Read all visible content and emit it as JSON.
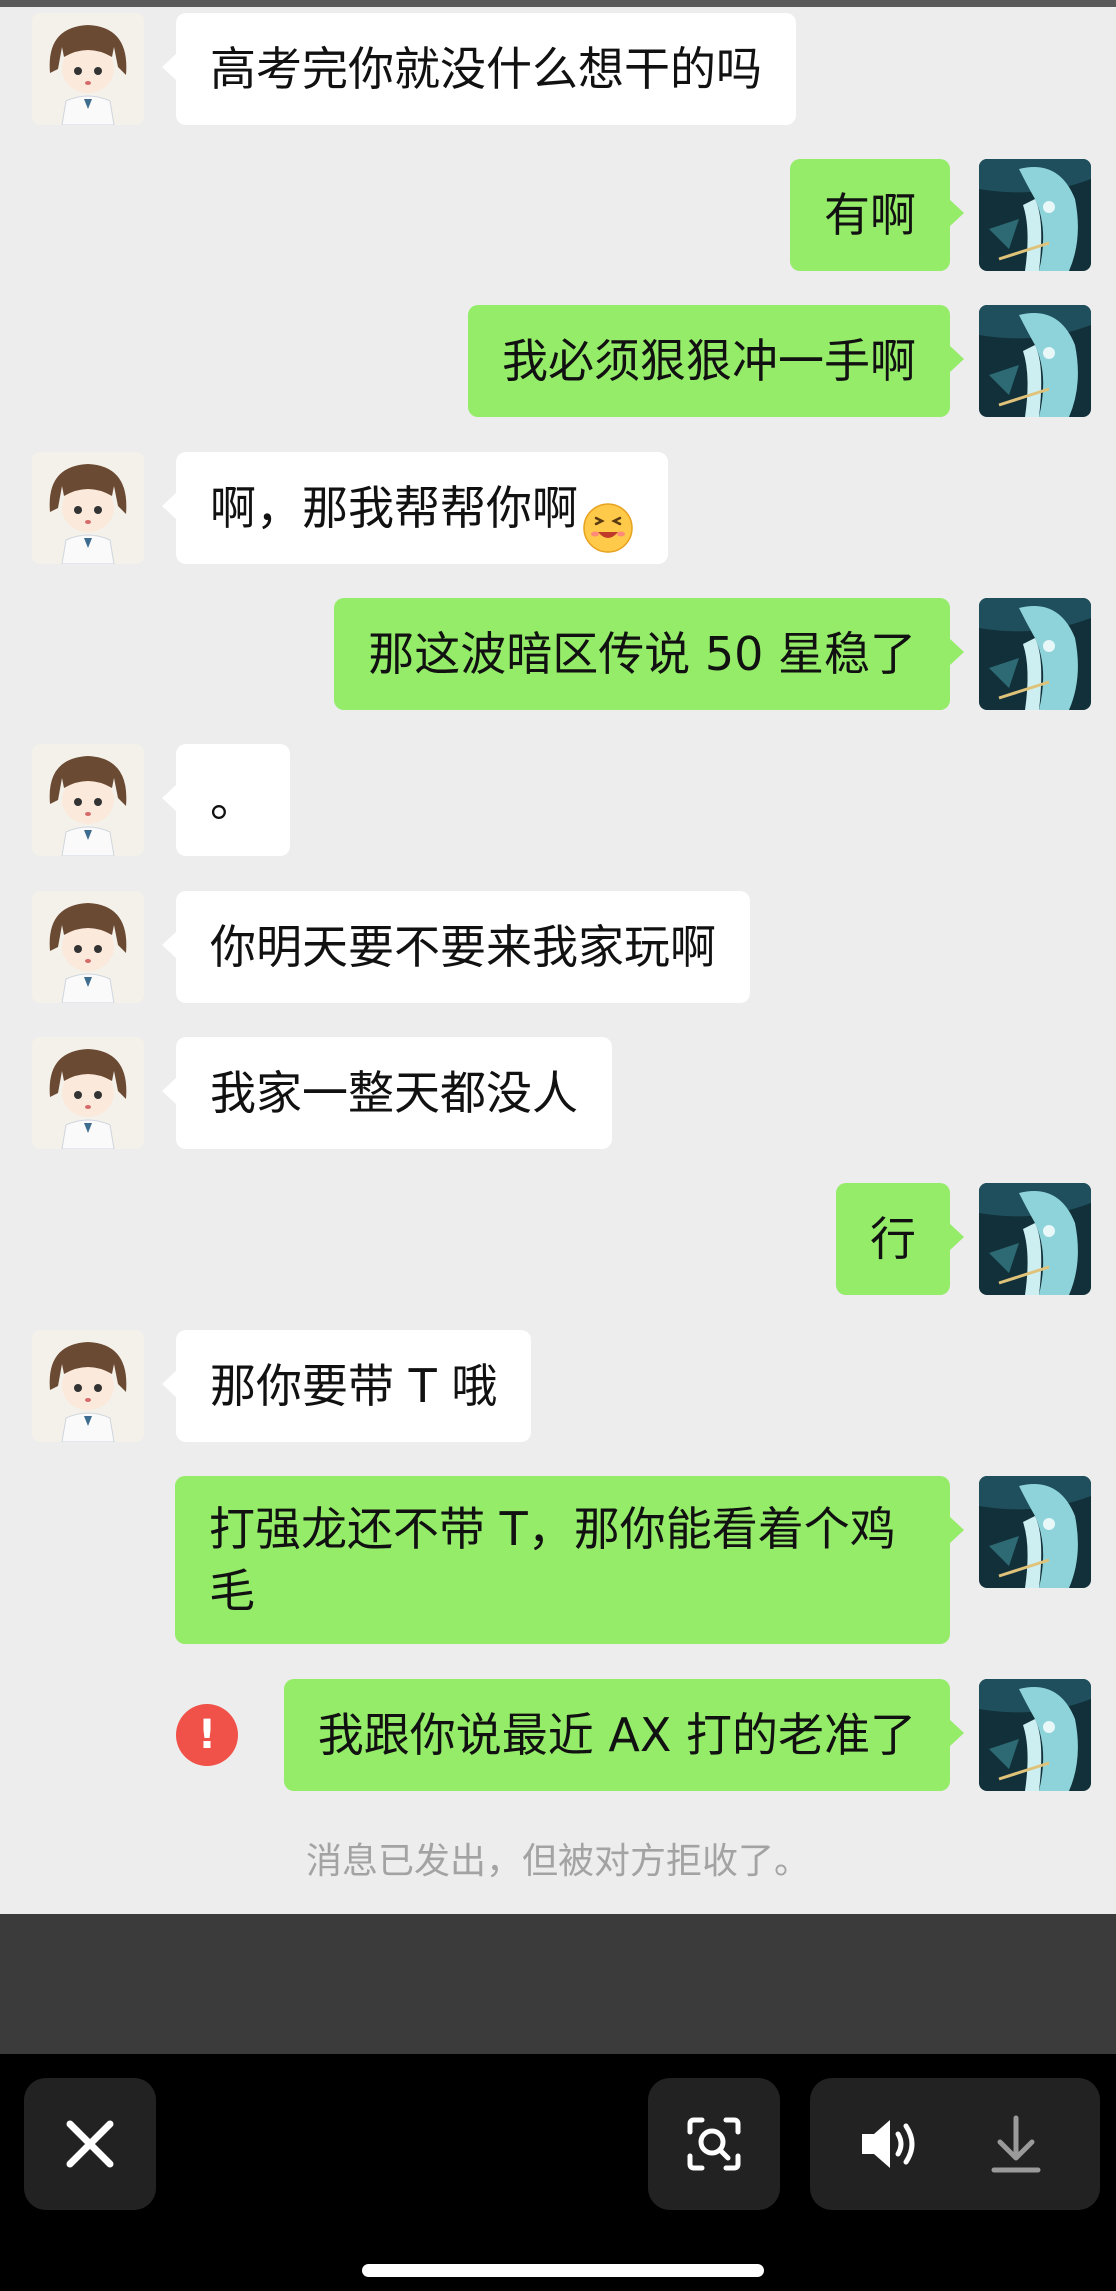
{
  "messages": [
    {
      "side": "left",
      "text": "高考完你就没什么想干的吗"
    },
    {
      "side": "right",
      "text": "有啊"
    },
    {
      "side": "right",
      "text": "我必须狠狠冲一手啊"
    },
    {
      "side": "left",
      "text": "啊，那我帮帮你啊"
    },
    {
      "side": "right",
      "text": "那这波暗区传说 50 星稳了"
    },
    {
      "side": "left",
      "text": "。"
    },
    {
      "side": "left",
      "text": "你明天要不要来我家玩啊"
    },
    {
      "side": "left",
      "text": "我家一整天都没人"
    },
    {
      "side": "right",
      "text": "行"
    },
    {
      "side": "left",
      "text": "那你要带 T 哦"
    },
    {
      "side": "right",
      "text": "打强龙还不带 T，那你能看着个鸡毛"
    },
    {
      "side": "right",
      "text": "我跟你说最近 AX 打的老准了",
      "status": "rejected"
    }
  ],
  "error_icon": {
    "glyph": "!",
    "icon": "exclamation-circle-icon",
    "color": "#f05148"
  },
  "system_note": "消息已发出，但被对方拒收了。",
  "emoji": {
    "icon": "laughing-face-emoji"
  },
  "colors": {
    "outgoing": "#95ec69",
    "incoming": "#ffffff",
    "background": "#ededed"
  },
  "toolbar": {
    "close_icon": "close-icon",
    "scan_icon": "scan-search-icon",
    "speaker_icon": "speaker-icon",
    "download_icon": "download-icon"
  }
}
